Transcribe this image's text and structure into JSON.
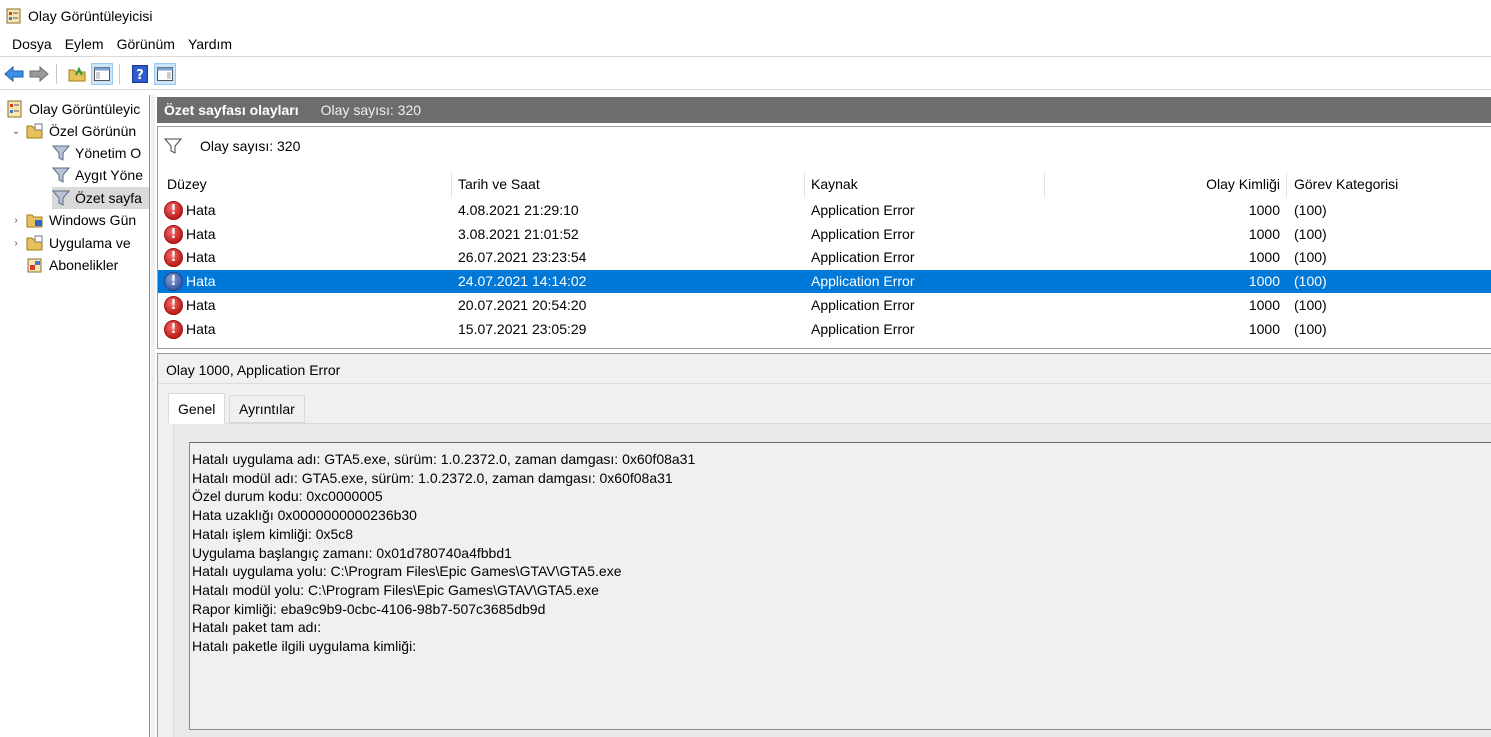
{
  "window": {
    "title": "Olay Görüntüleyicisi"
  },
  "menu": [
    "Dosya",
    "Eylem",
    "Görünüm",
    "Yardım"
  ],
  "toolbar": {
    "buttons": [
      "back-arrow-icon",
      "forward-arrow-icon",
      "open-folder-icon",
      "console-tree-icon",
      "help-icon",
      "action-pane-icon"
    ]
  },
  "tree": {
    "items": [
      {
        "label": "Olay Görüntüleyicisi (Yerel)",
        "visible": "Olay Görüntüleyic",
        "level": 0,
        "chev": "",
        "icon": "event-viewer-icon"
      },
      {
        "label": "Özel Görünümler",
        "visible": "Özel Görünün",
        "level": 1,
        "chev": "⌄",
        "icon": "custom-views-folder-icon"
      },
      {
        "label": "Yönetim Olayları",
        "visible": "Yönetim O",
        "level": 2,
        "chev": "",
        "icon": "filter-icon"
      },
      {
        "label": "Aygıt Yöneticisi",
        "visible": "Aygıt Yöne",
        "level": 2,
        "chev": "",
        "icon": "filter-icon"
      },
      {
        "label": "Özet sayfası olayları",
        "visible": "Özet sayfa",
        "level": 2,
        "chev": "",
        "icon": "filter-icon",
        "selected": true
      },
      {
        "label": "Windows Günlükleri",
        "visible": "Windows Gün",
        "level": 1,
        "chev": "›",
        "icon": "windows-logs-folder-icon"
      },
      {
        "label": "Uygulama ve Hizmet Günlükleri",
        "visible": "Uygulama ve",
        "level": 1,
        "chev": "›",
        "icon": "app-logs-folder-icon"
      },
      {
        "label": "Abonelikler",
        "visible": "Abonelikler",
        "level": 1,
        "chev": "",
        "icon": "subscriptions-icon"
      }
    ]
  },
  "summary": {
    "title": "Özet sayfası olayları",
    "count_label": "Olay sayısı: 320"
  },
  "events": {
    "filter_text": "Olay sayısı: 320",
    "columns": [
      "Düzey",
      "Tarih ve Saat",
      "Kaynak",
      "Olay Kimliği",
      "Görev Kategorisi"
    ],
    "rows": [
      {
        "level": "Hata",
        "datetime": "4.08.2021 21:29:10",
        "source": "Application Error",
        "event_id": "1000",
        "category": "(100)"
      },
      {
        "level": "Hata",
        "datetime": "3.08.2021 21:01:52",
        "source": "Application Error",
        "event_id": "1000",
        "category": "(100)"
      },
      {
        "level": "Hata",
        "datetime": "26.07.2021 23:23:54",
        "source": "Application Error",
        "event_id": "1000",
        "category": "(100)"
      },
      {
        "level": "Hata",
        "datetime": "24.07.2021 14:14:02",
        "source": "Application Error",
        "event_id": "1000",
        "category": "(100)",
        "selected": true
      },
      {
        "level": "Hata",
        "datetime": "20.07.2021 20:54:20",
        "source": "Application Error",
        "event_id": "1000",
        "category": "(100)"
      },
      {
        "level": "Hata",
        "datetime": "15.07.2021 23:05:29",
        "source": "Application Error",
        "event_id": "1000",
        "category": "(100)"
      }
    ]
  },
  "detail": {
    "title": "Olay 1000, Application Error",
    "tabs": [
      "Genel",
      "Ayrıntılar"
    ],
    "active_tab": "Genel",
    "description": [
      "Hatalı uygulama adı: GTA5.exe, sürüm: 1.0.2372.0, zaman damgası: 0x60f08a31",
      "Hatalı modül adı: GTA5.exe, sürüm: 1.0.2372.0, zaman damgası: 0x60f08a31",
      "Özel durum kodu: 0xc0000005",
      "Hata uzaklığı 0x0000000000236b30",
      "Hatalı işlem kimliği: 0x5c8",
      "Uygulama başlangıç zamanı: 0x01d780740a4fbbd1",
      "Hatalı uygulama yolu: C:\\Program Files\\Epic Games\\GTAV\\GTA5.exe",
      "Hatalı modül yolu: C:\\Program Files\\Epic Games\\GTAV\\GTA5.exe",
      "Rapor kimliği: eba9c9b9-0cbc-4106-98b7-507c3685db9d",
      "Hatalı paket tam adı:",
      "Hatalı paketle ilgili uygulama kimliği:"
    ]
  }
}
